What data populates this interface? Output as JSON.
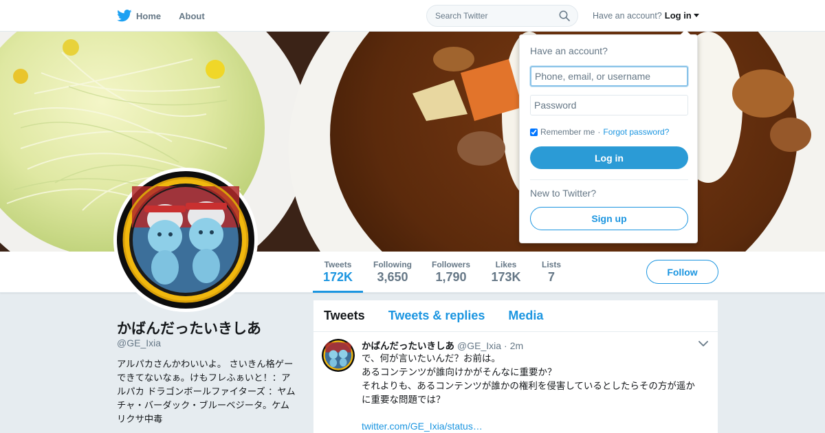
{
  "nav": {
    "home_label": "Home",
    "about_label": "About",
    "search_placeholder": "Search Twitter",
    "account_prompt": "Have an account?",
    "login_label": "Log in",
    "brand_color": "#1da1f2"
  },
  "profile": {
    "name": "かばんだったいきしあ",
    "handle": "@GE_Ixia",
    "bio": "アルパカさんかわいいよ。 さいきん格ゲーできてないなぁ。けもフレふぁいと！：アルパカ ドラゴンボールファイターズ ：ヤムチャ・バーダック・ブルーベジータ。ケムリクサ中毒",
    "follow_label": "Follow"
  },
  "stats": [
    {
      "label": "Tweets",
      "value": "172K",
      "active": true
    },
    {
      "label": "Following",
      "value": "3,650"
    },
    {
      "label": "Followers",
      "value": "1,790"
    },
    {
      "label": "Likes",
      "value": "173K"
    },
    {
      "label": "Lists",
      "value": "7"
    }
  ],
  "timeline": {
    "tabs": [
      "Tweets",
      "Tweets & replies",
      "Media"
    ],
    "tweet": {
      "name": "かばんだったいきしあ",
      "handle": "@GE_Ixia",
      "dot": "·",
      "time": "2m",
      "lines": [
        "で、何が言いたいんだ？お前は。",
        "あるコンテンツが誰向けかがそんなに重要か？",
        "それよりも、あるコンテンツが誰かの権利を侵害しているとしたらその方が遥か",
        "に重要な問題では？"
      ],
      "link": "twitter.com/GE_Ixia/status…"
    }
  },
  "login_dropdown": {
    "title": "Have an account?",
    "username_placeholder": "Phone, email, or username",
    "password_placeholder": "Password",
    "remember_label": "Remember me",
    "separator": "·",
    "forgot_label": "Forgot password?",
    "login_button": "Log in",
    "new_prompt": "New to Twitter?",
    "signup_button": "Sign up",
    "remember_checked": true
  },
  "colors": {
    "accent": "#1b95e0",
    "login_button": "#2b9bd6",
    "background": "#e6ecf0"
  }
}
